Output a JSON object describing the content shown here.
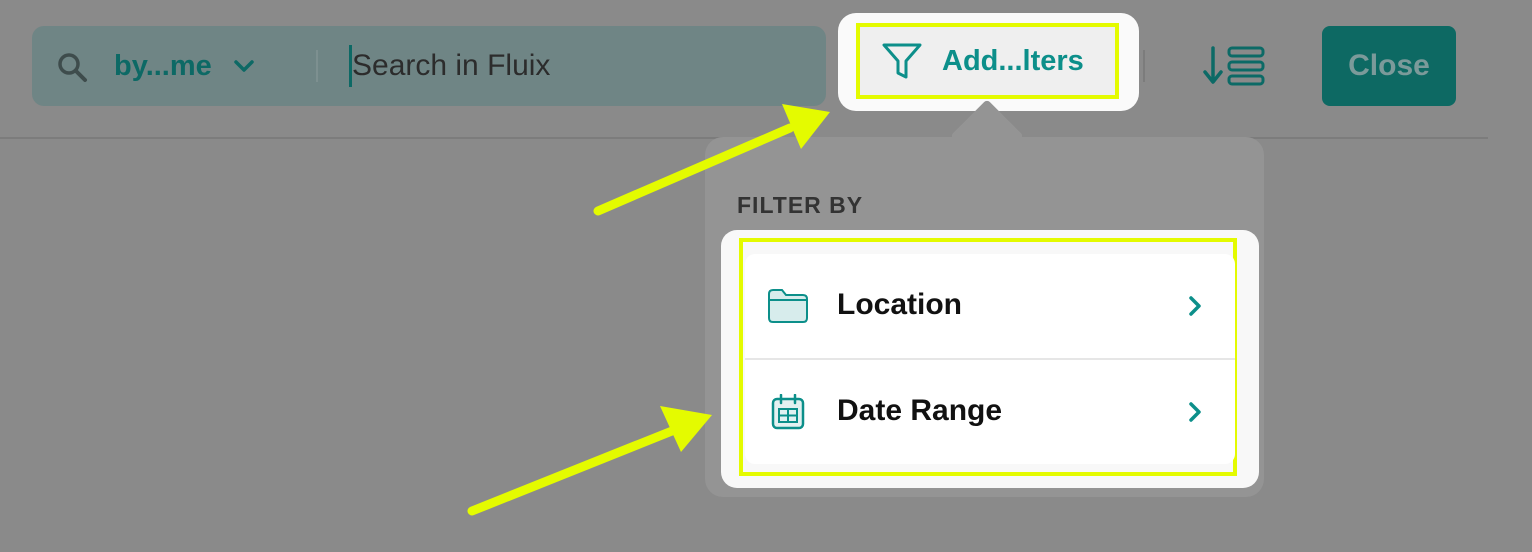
{
  "search": {
    "scope_label": "by...me",
    "placeholder": "Search in Fluix"
  },
  "toolbar": {
    "filters_label": "Add...lters",
    "close_label": "Close"
  },
  "popover": {
    "title": "FILTER BY",
    "options": [
      {
        "label": "Location",
        "icon": "folder-icon"
      },
      {
        "label": "Date Range",
        "icon": "calendar-icon"
      }
    ]
  },
  "colors": {
    "accent": "#0c8f8a",
    "close_button": "#0d6963",
    "highlight": "#e4fb00",
    "overlay": "#8a8a8a"
  }
}
